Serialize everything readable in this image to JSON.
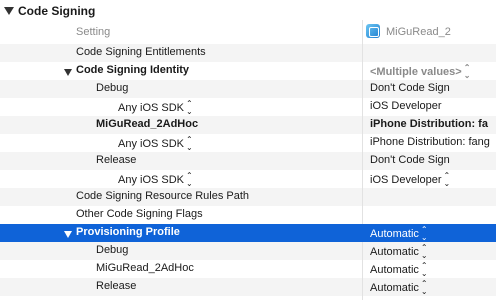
{
  "section": {
    "title": "Code Signing"
  },
  "columns": {
    "setting_header": "Setting",
    "target_name": "MiGuRead_2"
  },
  "rows": [
    {
      "label": "Code Signing Entitlements",
      "value": ""
    },
    {
      "label": "Code Signing Identity",
      "value": "<Multiple values>"
    },
    {
      "label": "Debug",
      "value": "Don't Code Sign"
    },
    {
      "label": "Any iOS SDK",
      "value": "iOS Developer"
    },
    {
      "label": "MiGuRead_2AdHoc",
      "value": "iPhone Distribution: fa"
    },
    {
      "label": "Any iOS SDK",
      "value": "iPhone Distribution: fang"
    },
    {
      "label": "Release",
      "value": "Don't Code Sign"
    },
    {
      "label": "Any iOS SDK",
      "value": "iOS Developer"
    },
    {
      "label": "Code Signing Resource Rules Path",
      "value": ""
    },
    {
      "label": "Other Code Signing Flags",
      "value": ""
    },
    {
      "label": "Provisioning Profile",
      "value": "Automatic"
    },
    {
      "label": "Debug",
      "value": "Automatic"
    },
    {
      "label": "MiGuRead_2AdHoc",
      "value": "Automatic"
    },
    {
      "label": "Release",
      "value": "Automatic"
    }
  ],
  "icons": {
    "disclosure": "disclosure-triangle-icon",
    "stepper": "up-down-arrows-icon",
    "target": "app-target-icon"
  },
  "colors": {
    "selection": "#0f63d8",
    "alt_row": "#f4f4f4"
  }
}
